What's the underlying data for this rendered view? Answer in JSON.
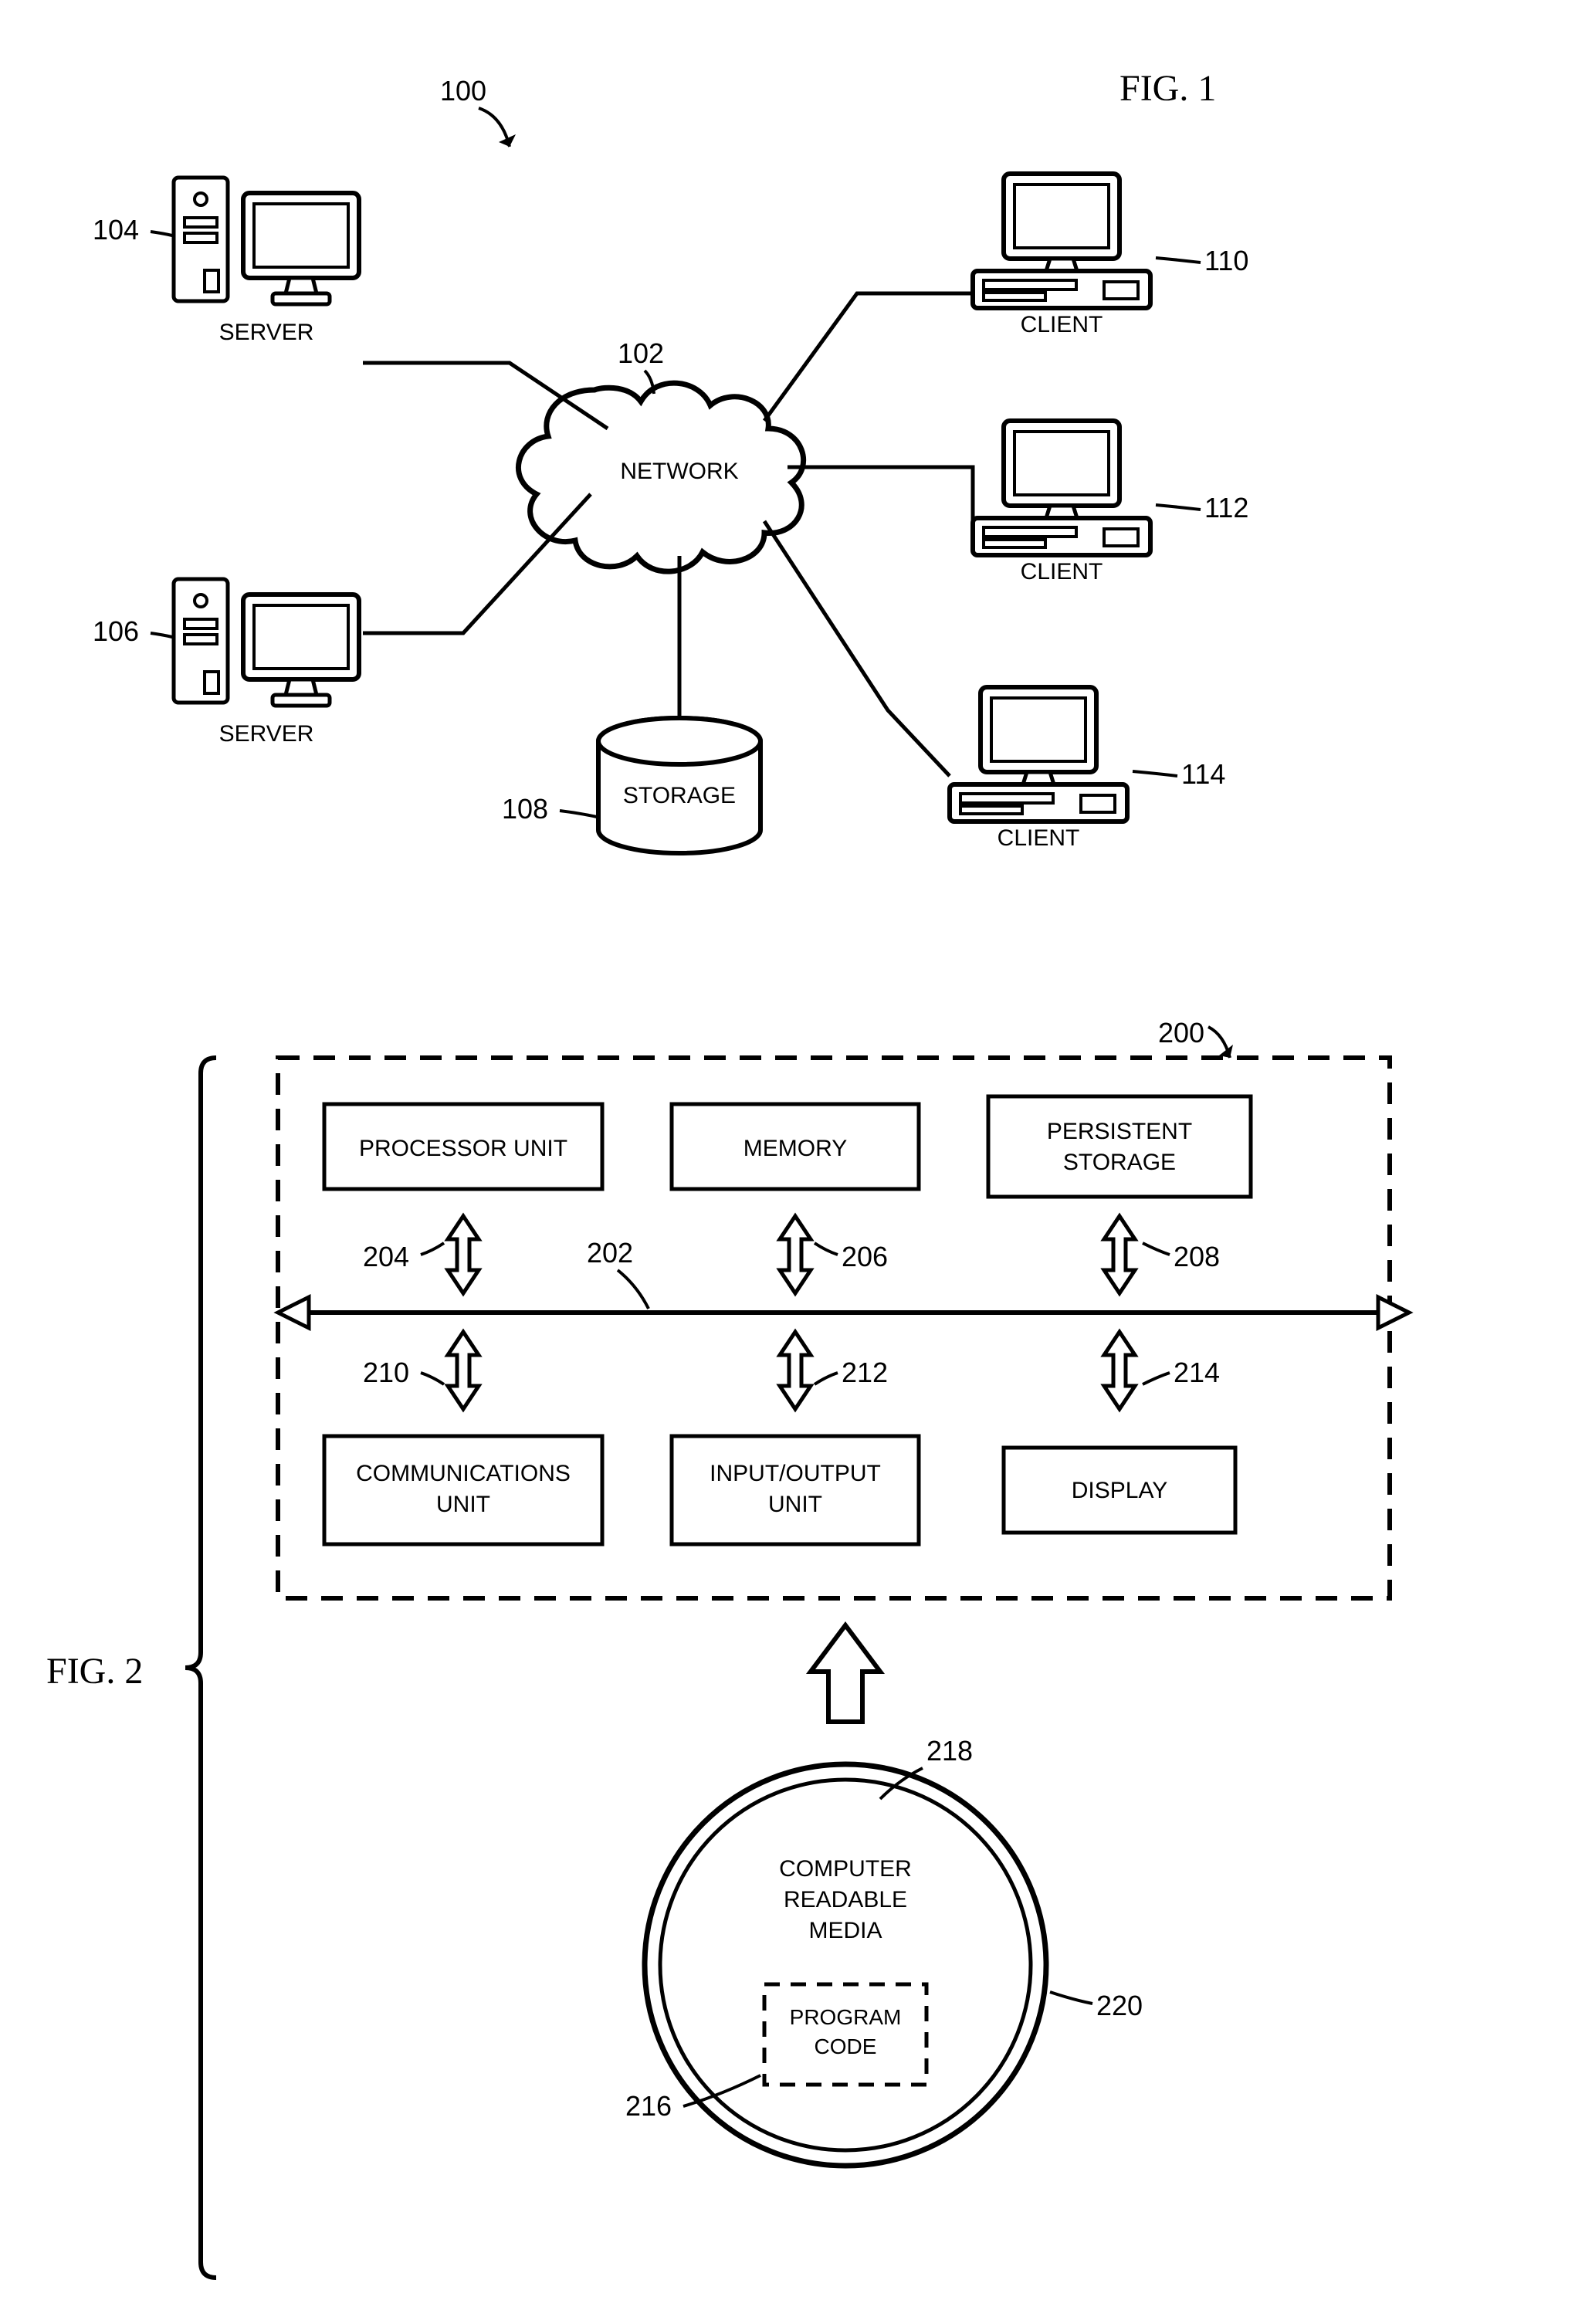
{
  "figures": {
    "fig1": {
      "title": "FIG. 1",
      "system_ref": "100",
      "network": {
        "label": "NETWORK",
        "ref": "102"
      },
      "servers": [
        {
          "label": "SERVER",
          "ref": "104"
        },
        {
          "label": "SERVER",
          "ref": "106"
        }
      ],
      "storage": {
        "label": "STORAGE",
        "ref": "108"
      },
      "clients": [
        {
          "label": "CLIENT",
          "ref": "110"
        },
        {
          "label": "CLIENT",
          "ref": "112"
        },
        {
          "label": "CLIENT",
          "ref": "114"
        }
      ]
    },
    "fig2": {
      "title": "FIG. 2",
      "system_ref": "200",
      "bus_ref": "202",
      "blocks": {
        "processor": {
          "label": "PROCESSOR UNIT",
          "ref": "204"
        },
        "memory": {
          "label": "MEMORY",
          "ref": "206"
        },
        "persistent": {
          "label_l1": "PERSISTENT",
          "label_l2": "STORAGE",
          "ref": "208"
        },
        "comm": {
          "label_l1": "COMMUNICATIONS",
          "label_l2": "UNIT",
          "ref": "210"
        },
        "io": {
          "label_l1": "INPUT/OUTPUT",
          "label_l2": "UNIT",
          "ref": "212"
        },
        "display": {
          "label": "DISPLAY",
          "ref": "214"
        }
      },
      "media": {
        "label_l1": "COMPUTER",
        "label_l2": "READABLE",
        "label_l3": "MEDIA",
        "ref": "218",
        "outer_ref": "220",
        "program": {
          "label_l1": "PROGRAM",
          "label_l2": "CODE",
          "ref": "216"
        }
      }
    }
  }
}
